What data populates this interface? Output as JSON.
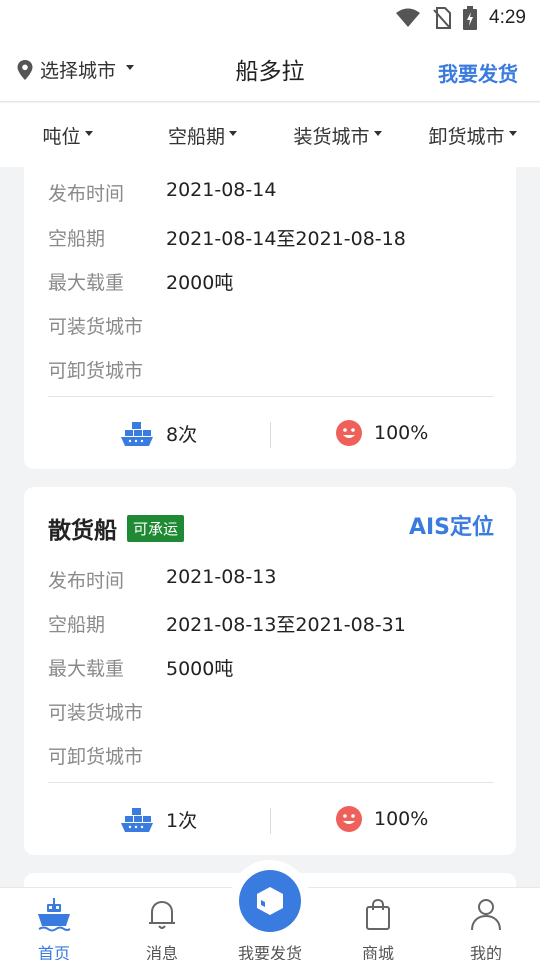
{
  "status_bar": {
    "time": "4:29"
  },
  "header": {
    "city_select": "选择城市",
    "title": "船多拉",
    "ship_cargo_button": "我要发货"
  },
  "filters": [
    {
      "label": "吨位"
    },
    {
      "label": "空船期"
    },
    {
      "label": "装货城市"
    },
    {
      "label": "卸货城市"
    }
  ],
  "field_labels": {
    "publish_time": "发布时间",
    "empty_period": "空船期",
    "max_load": "最大载重",
    "loading_city": "可装货城市",
    "unloading_city": "可卸货城市"
  },
  "cards": [
    {
      "publish_time": "2021-08-14",
      "empty_period": "2021-08-14至2021-08-18",
      "max_load": "2000吨",
      "loading_city": "",
      "unloading_city": "",
      "trips": "8次",
      "rating": "100%"
    },
    {
      "ship_type": "散货船",
      "badge": "可承运",
      "ais_button": "AIS定位",
      "publish_time": "2021-08-13",
      "empty_period": "2021-08-13至2021-08-31",
      "max_load": "5000吨",
      "loading_city": "",
      "unloading_city": "",
      "trips": "1次",
      "rating": "100%"
    }
  ],
  "tabbar": {
    "home": "首页",
    "messages": "消息",
    "ship_cargo": "我要发货",
    "mall": "商城",
    "mine": "我的"
  },
  "colors": {
    "accent": "#3a7be0",
    "badge": "#1f8a33",
    "smile": "#f0605a"
  }
}
